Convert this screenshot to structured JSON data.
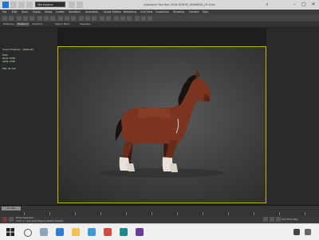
{
  "titlebar": {
    "workspace": "Workspace: Default",
    "app_title": "Autodesk 3ds Max 2018   HORSE_DRAWING_01.max",
    "minimize": "–",
    "maximize": "▢",
    "close": "✕"
  },
  "menu": {
    "items": [
      "File",
      "Edit",
      "Tools",
      "Group",
      "Views",
      "Create",
      "Modifiers",
      "Animation",
      "Graph Editors",
      "Rendering",
      "Civil View",
      "Customize",
      "Scripting",
      "Content",
      "Help"
    ]
  },
  "ribbon": {
    "tabs": [
      "Modeling",
      "Freeform",
      "Selection",
      "Object Paint",
      "Populate"
    ],
    "active_index": 1
  },
  "left_panel": {
    "scene_explorer": "Scene Explorer - [Default]",
    "stats": [
      {
        "label": "Total",
        "value": ""
      },
      {
        "label": "Polys:",
        "value": "5745"
      },
      {
        "label": "Verts:",
        "value": "5742"
      },
      {
        "label": "FPS:",
        "value": "34.134"
      }
    ]
  },
  "viewport": {
    "label": "[+] [Perspective] [Default Shading]",
    "accent": "#c8b400"
  },
  "timeline": {
    "slider_label": "0 / 100"
  },
  "status": {
    "line1": "None Selected",
    "line2": "Click or click-and-drag to select objects",
    "add_time_tag": "Add Time Tag"
  },
  "colors": {
    "horse_body": "#7a3420",
    "horse_mane": "#1a1210",
    "horse_socks": "#e8e2da"
  }
}
